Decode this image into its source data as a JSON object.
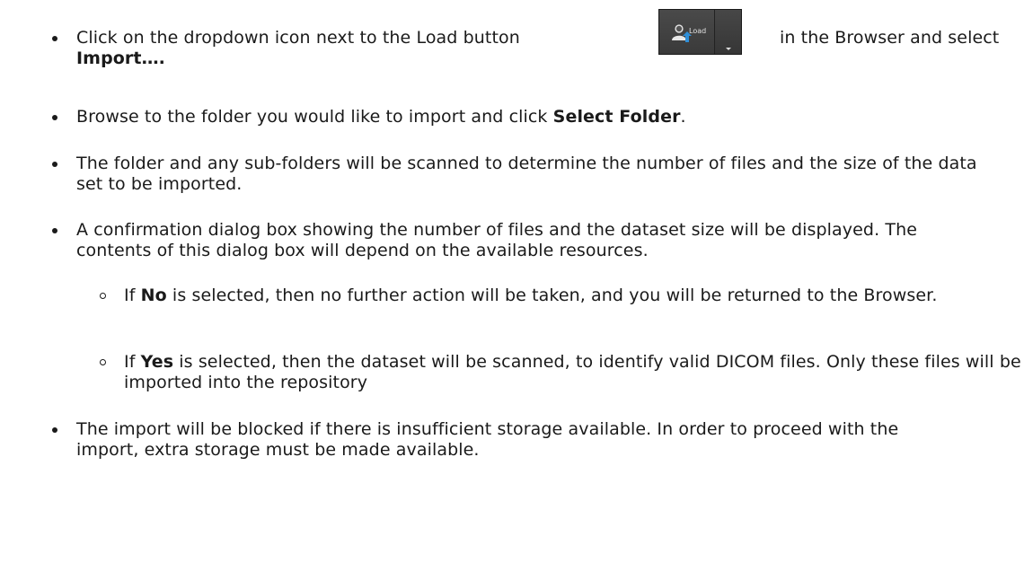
{
  "items": [
    {
      "level": 1,
      "segments": [
        {
          "text": "Click on the dropdown icon next to the Load button "
        },
        {
          "widget": "load-button"
        },
        {
          "text": " in the Browser and select"
        }
      ],
      "line2": [
        {
          "text": "Import….",
          "bold": true
        }
      ]
    },
    {
      "level": 1,
      "segments": [
        {
          "text": "Browse to the folder you would like to import and click "
        },
        {
          "text": "Select Folder",
          "bold": true
        },
        {
          "text": "."
        }
      ]
    },
    {
      "level": 1,
      "segments": [
        {
          "text": "The folder and any sub-folders will be scanned to determine the number of files and the size of the data set to be imported."
        }
      ]
    },
    {
      "level": 1,
      "segments": [
        {
          "text": "A confirmation dialog box showing the number of files and the dataset size will be displayed. The contents of this dialog box will depend on the available resources."
        }
      ]
    },
    {
      "level": 2,
      "segments": [
        {
          "text": "If "
        },
        {
          "text": "No",
          "bold": true
        },
        {
          "text": " is selected, then no further action will be taken, and you will be returned to the Browser."
        }
      ]
    },
    {
      "level": 2,
      "segments": [
        {
          "text": "If "
        },
        {
          "text": "Yes",
          "bold": true
        },
        {
          "text": " is selected, then the dataset will be scanned, to identify valid DICOM files. Only these files will be imported into the repository"
        }
      ]
    },
    {
      "level": 1,
      "segments": [
        {
          "text": "The import will be blocked if there is insufficient storage available. In order to proceed with the import, extra storage must be made available."
        }
      ]
    }
  ],
  "load_button": {
    "label": "Load",
    "icon": "user-upload-icon",
    "dropdown_icon": "caret-down-icon",
    "colors": {
      "background": "#3f3f3f",
      "icon_person": "#e8e8e8",
      "icon_arrow": "#2f8fd8"
    }
  }
}
